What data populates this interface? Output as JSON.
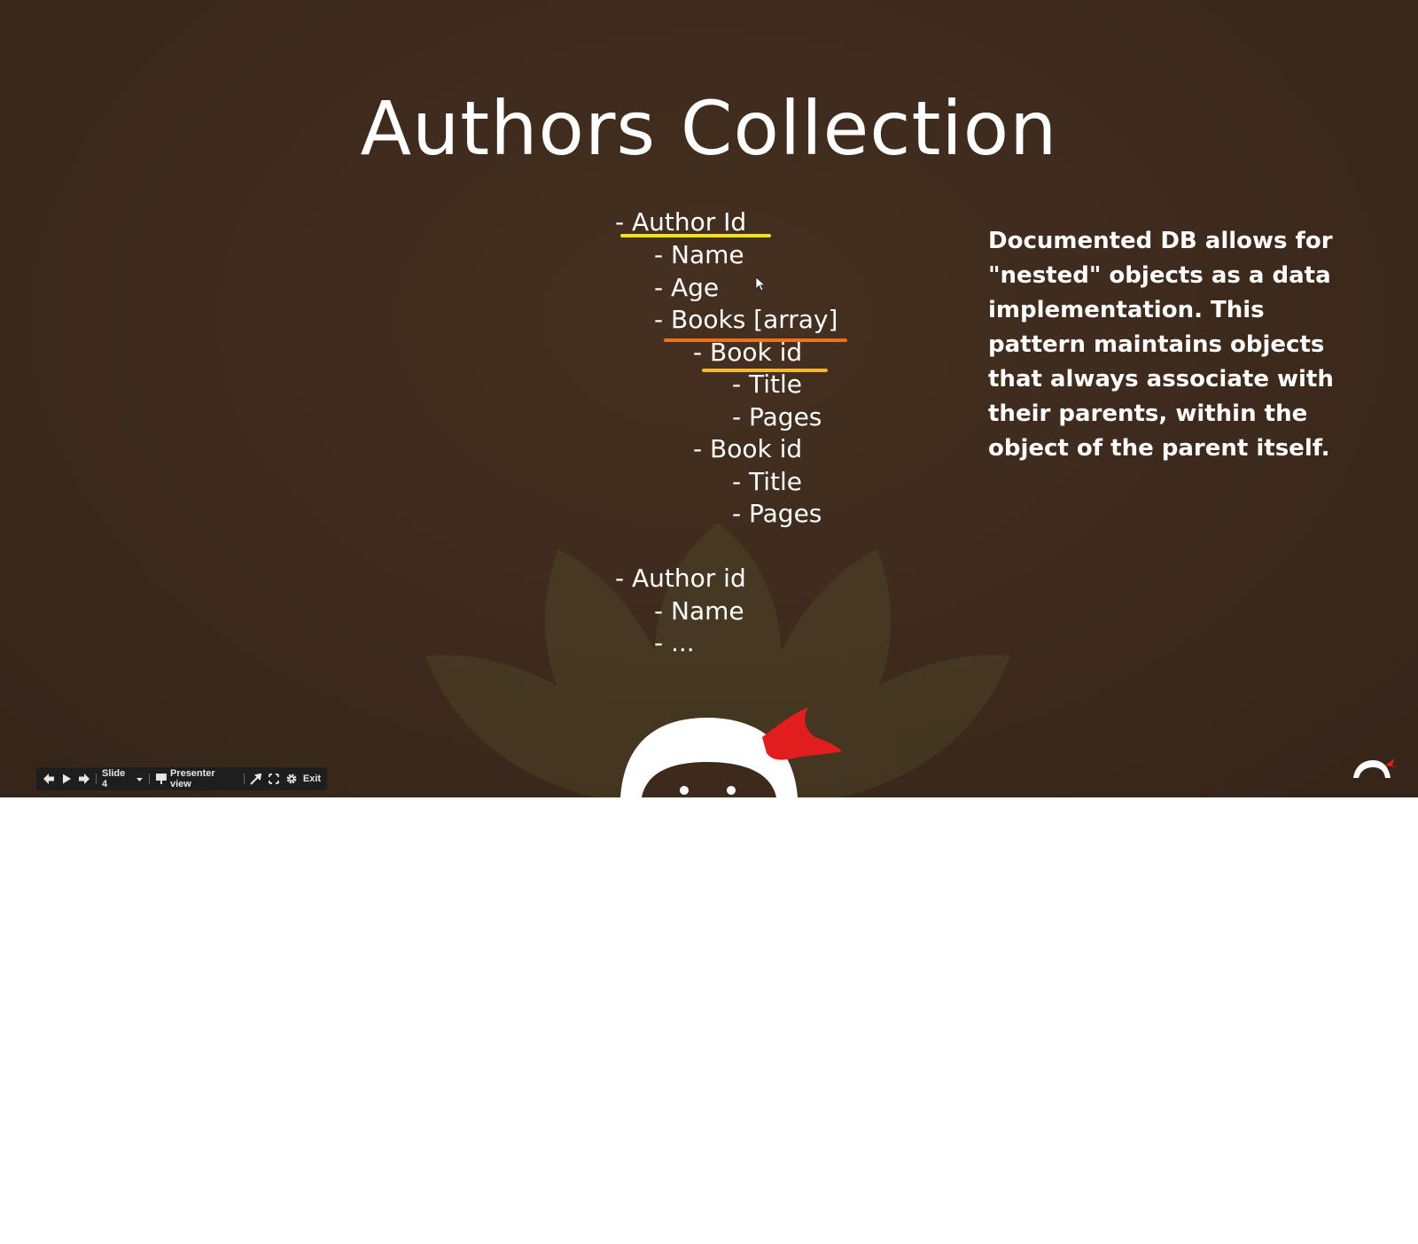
{
  "slide": {
    "title": "Authors Collection",
    "tree": [
      {
        "text": "- Author Id",
        "level": 0,
        "highlight": "#f2e21a"
      },
      {
        "text": "- Name",
        "level": 1
      },
      {
        "text": "- Age",
        "level": 1
      },
      {
        "text": "- Books [array]",
        "level": 1,
        "highlight": "#f0701e"
      },
      {
        "text": "- Book id",
        "level": 2,
        "highlight": "#f5b82a"
      },
      {
        "text": "- Title",
        "level": 3
      },
      {
        "text": "- Pages",
        "level": 3
      },
      {
        "text": "- Book id",
        "level": 2
      },
      {
        "text": "- Title",
        "level": 3
      },
      {
        "text": "- Pages",
        "level": 3
      },
      {
        "text": "- Author id",
        "level": 0
      },
      {
        "text": "- Name",
        "level": 1
      },
      {
        "text": "- ...",
        "level": 1
      }
    ],
    "explanation": "Documented DB allows for \"nested\" objects as a data implementation. This pattern maintains objects that always associate with their parents, within the object of the parent itself."
  },
  "toolbar": {
    "slide_label": "Slide 4",
    "presenter_label": "Presenter view",
    "exit_label": "Exit",
    "icons": [
      "arrow-left-icon",
      "play-icon",
      "arrow-right-icon",
      "chevron-down-icon",
      "presenter-icon",
      "laser-pointer-icon",
      "fullscreen-icon",
      "gear-icon"
    ]
  },
  "colors": {
    "slide_background": "#3d2a1d",
    "yellow_highlight": "#f2e21a",
    "orange_highlight": "#f0701e",
    "amber_highlight": "#f5b82a",
    "mascot_bandana": "#e11d1d"
  }
}
